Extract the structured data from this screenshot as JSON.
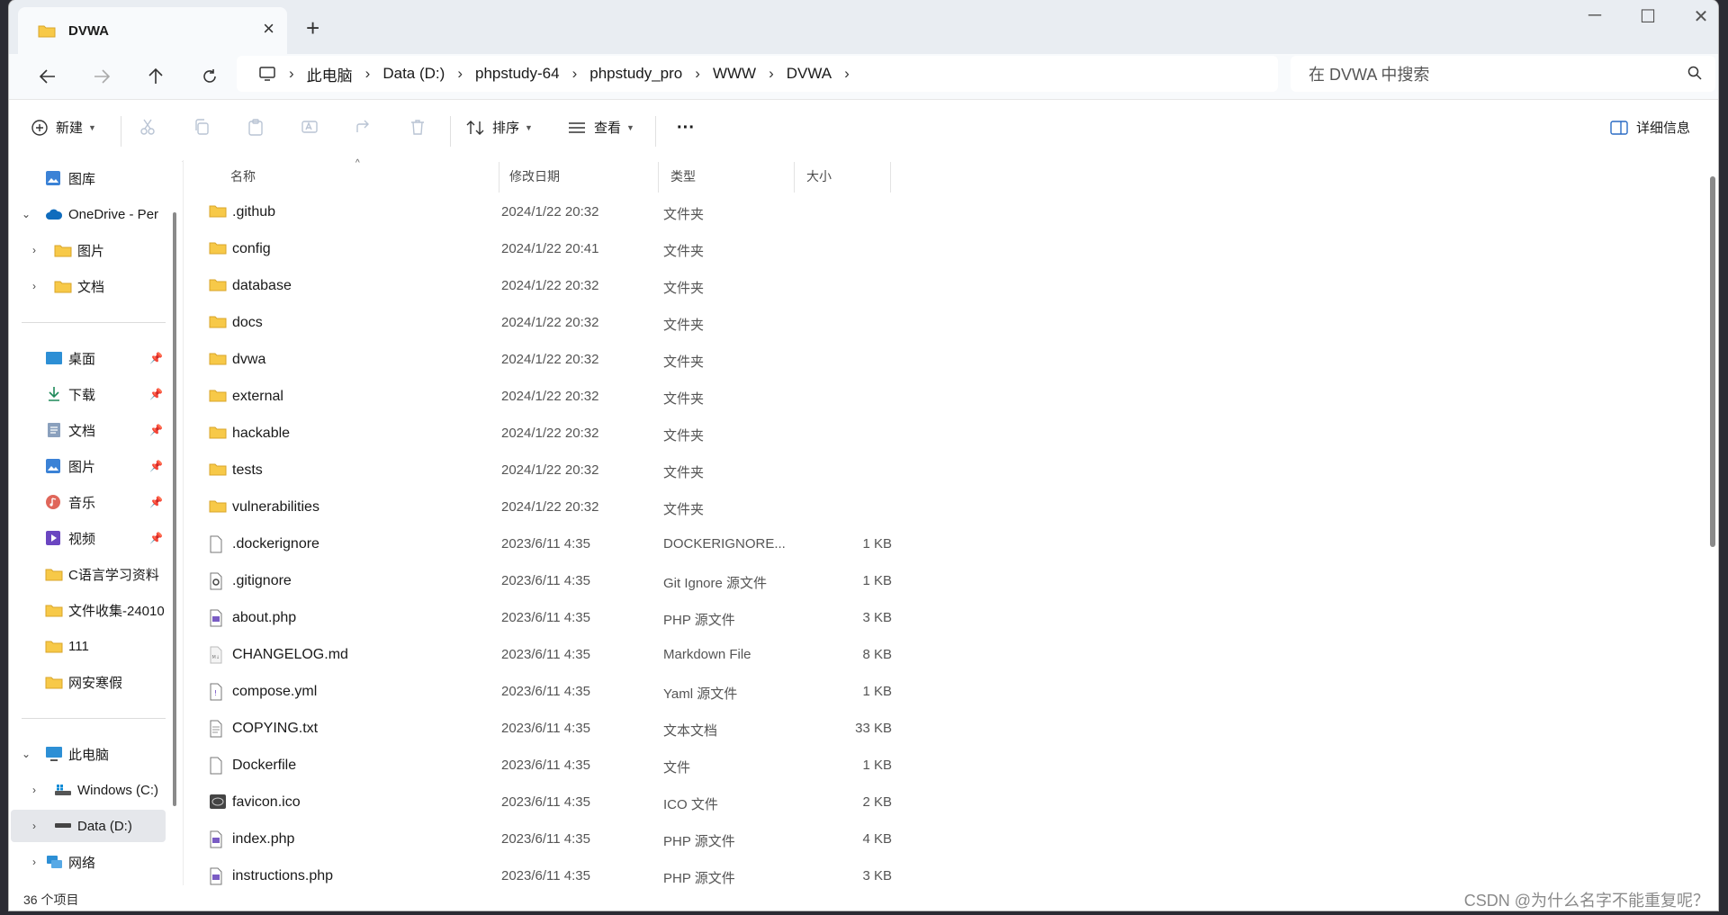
{
  "window": {
    "tab_title": "DVWA",
    "controls": {
      "minimize": "─",
      "maximize": "☐",
      "close": "✕"
    }
  },
  "breadcrumb": [
    "此电脑",
    "Data (D:)",
    "phpstudy-64",
    "phpstudy_pro",
    "WWW",
    "DVWA"
  ],
  "search": {
    "placeholder": "在 DVWA 中搜索"
  },
  "toolbar": {
    "new_label": "新建",
    "sort_label": "排序",
    "view_label": "查看",
    "more_label": "···",
    "details_label": "详细信息"
  },
  "sidebar": {
    "gallery": "图库",
    "onedrive": "OneDrive - Per",
    "od_pictures": "图片",
    "od_docs": "文档",
    "quick": [
      {
        "label": "桌面",
        "icon": "desktop-icon",
        "pinned": true
      },
      {
        "label": "下载",
        "icon": "download-icon",
        "pinned": true
      },
      {
        "label": "文档",
        "icon": "document-icon",
        "pinned": true
      },
      {
        "label": "图片",
        "icon": "picture-icon",
        "pinned": true
      },
      {
        "label": "音乐",
        "icon": "music-icon",
        "pinned": true
      },
      {
        "label": "视频",
        "icon": "video-icon",
        "pinned": true
      },
      {
        "label": "C语言学习资料",
        "icon": "folder-icon",
        "pinned": false
      },
      {
        "label": "文件收集-24010",
        "icon": "folder-icon",
        "pinned": false
      },
      {
        "label": "111",
        "icon": "folder-icon",
        "pinned": false
      },
      {
        "label": "网安寒假",
        "icon": "folder-icon",
        "pinned": false
      }
    ],
    "this_pc": "此电脑",
    "drive_c": "Windows (C:)",
    "drive_d": "Data (D:)",
    "network": "网络"
  },
  "columns": {
    "name": "名称",
    "date": "修改日期",
    "type": "类型",
    "size": "大小"
  },
  "files": [
    {
      "name": ".github",
      "date": "2024/1/22 20:32",
      "type": "文件夹",
      "size": "",
      "kind": "folder"
    },
    {
      "name": "config",
      "date": "2024/1/22 20:41",
      "type": "文件夹",
      "size": "",
      "kind": "folder"
    },
    {
      "name": "database",
      "date": "2024/1/22 20:32",
      "type": "文件夹",
      "size": "",
      "kind": "folder"
    },
    {
      "name": "docs",
      "date": "2024/1/22 20:32",
      "type": "文件夹",
      "size": "",
      "kind": "folder"
    },
    {
      "name": "dvwa",
      "date": "2024/1/22 20:32",
      "type": "文件夹",
      "size": "",
      "kind": "folder"
    },
    {
      "name": "external",
      "date": "2024/1/22 20:32",
      "type": "文件夹",
      "size": "",
      "kind": "folder"
    },
    {
      "name": "hackable",
      "date": "2024/1/22 20:32",
      "type": "文件夹",
      "size": "",
      "kind": "folder"
    },
    {
      "name": "tests",
      "date": "2024/1/22 20:32",
      "type": "文件夹",
      "size": "",
      "kind": "folder"
    },
    {
      "name": "vulnerabilities",
      "date": "2024/1/22 20:32",
      "type": "文件夹",
      "size": "",
      "kind": "folder"
    },
    {
      "name": ".dockerignore",
      "date": "2023/6/11 4:35",
      "type": "DOCKERIGNORE...",
      "size": "1 KB",
      "kind": "file"
    },
    {
      "name": ".gitignore",
      "date": "2023/6/11 4:35",
      "type": "Git Ignore 源文件",
      "size": "1 KB",
      "kind": "gear"
    },
    {
      "name": "about.php",
      "date": "2023/6/11 4:35",
      "type": "PHP 源文件",
      "size": "3 KB",
      "kind": "php"
    },
    {
      "name": "CHANGELOG.md",
      "date": "2023/6/11 4:35",
      "type": "Markdown File",
      "size": "8 KB",
      "kind": "md"
    },
    {
      "name": "compose.yml",
      "date": "2023/6/11 4:35",
      "type": "Yaml 源文件",
      "size": "1 KB",
      "kind": "yml"
    },
    {
      "name": "COPYING.txt",
      "date": "2023/6/11 4:35",
      "type": "文本文档",
      "size": "33 KB",
      "kind": "txt"
    },
    {
      "name": "Dockerfile",
      "date": "2023/6/11 4:35",
      "type": "文件",
      "size": "1 KB",
      "kind": "file"
    },
    {
      "name": "favicon.ico",
      "date": "2023/6/11 4:35",
      "type": "ICO 文件",
      "size": "2 KB",
      "kind": "ico"
    },
    {
      "name": "index.php",
      "date": "2023/6/11 4:35",
      "type": "PHP 源文件",
      "size": "4 KB",
      "kind": "php"
    },
    {
      "name": "instructions.php",
      "date": "2023/6/11 4:35",
      "type": "PHP 源文件",
      "size": "3 KB",
      "kind": "php"
    }
  ],
  "status": {
    "item_count": "36 个项目"
  },
  "watermark": "CSDN @为什么名字不能重复呢？"
}
